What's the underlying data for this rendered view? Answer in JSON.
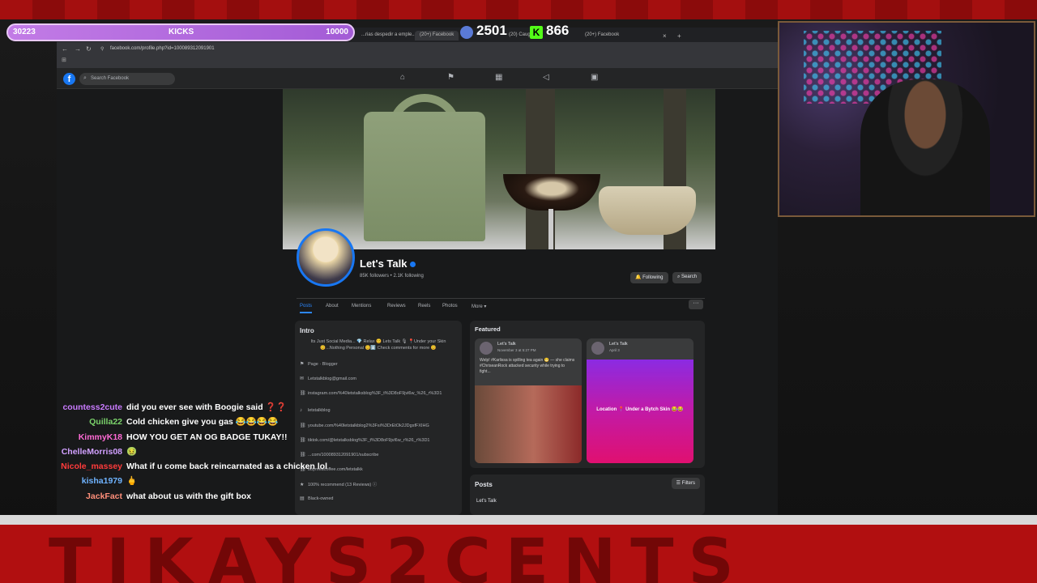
{
  "kicks_bar": {
    "left_count": "30223",
    "label": "KICKS",
    "goal": "10000"
  },
  "counters": {
    "viewers": "2501",
    "kick_count": "866"
  },
  "browser": {
    "tabs": [
      "...rias despedir a emple...",
      "(20+) Facebook",
      "(20) Caught...",
      "(20+) Facebook"
    ],
    "url": "facebook.com/profile.php?id=100089312091901"
  },
  "facebook": {
    "search_placeholder": "Search Facebook",
    "page_name": "Let's Talk",
    "stats": "85K followers • 2.1K following",
    "following_label": "Following",
    "search_label": "Search",
    "tabs": [
      "Posts",
      "About",
      "Mentions",
      "Reviews",
      "Reels",
      "Photos",
      "More ▾"
    ],
    "intro": {
      "title": "Intro",
      "bio": "Its Just Social Media... 💎 Relax 😊 Lets Talk 🎙 📍Under your Skin 😊...Nothing Personal 😊⬇️ Check comments for more 😊",
      "rows": [
        {
          "icon": "flag-icon",
          "text": "Page · Blogger"
        },
        {
          "icon": "mail-icon",
          "text": "Letstalkblog@gmail.com"
        },
        {
          "icon": "link-icon",
          "text": "instagram.com/%40letstalksblog%3F_t%3D8oF9jvl6w_%26_r%3D1"
        },
        {
          "icon": "tiktok-icon",
          "text": "letstalkblog"
        },
        {
          "icon": "link-icon",
          "text": "youtube.com/%40letstalkblog2%3Fsi%3DrEtOk2JDgsfFXIHG"
        },
        {
          "icon": "link-icon",
          "text": "tiktok.com/@letstalksblog%3F_t%3D8oF9jvl6w_r%26_r%3D1"
        },
        {
          "icon": "link-icon",
          "text": "...com/100089312091901/subscribe"
        },
        {
          "icon": "link-icon",
          "text": "buymeacoffee.com/letstalkk"
        },
        {
          "icon": "star-icon",
          "text": "100% recommend (13 Reviews) ⓘ"
        },
        {
          "icon": "lock-icon",
          "text": "Black-owned"
        }
      ]
    },
    "featured": {
      "title": "Featured",
      "card1": {
        "name": "Let's Talk",
        "date": "November 3 at 5:27 PM",
        "text": "Welp! #Karlissa is spilling tea again 😬 — she claims #ChriseanRock attacked security while trying to fight..."
      },
      "card2": {
        "name": "Let's Talk",
        "date": "April 3",
        "text": "Location 📍 Under a Bytch Skin 😂😂"
      }
    },
    "posts": {
      "title": "Posts",
      "filters_label": "Filters",
      "author": "Let's Talk"
    }
  },
  "chat": [
    {
      "user": "countess2cute",
      "color": "#c97bff",
      "msg": "did you ever see with Boogie said ❓❓"
    },
    {
      "user": "Quilla22",
      "color": "#7bd36b",
      "msg": "Cold chicken give you gas 😂😂😂😂"
    },
    {
      "user": "KimmyK18",
      "color": "#ff6ad5",
      "msg": "HOW YOU GET AN OG BADGE TUKAY!!"
    },
    {
      "user": "ChelleMorris08",
      "color": "#d1a0ff",
      "msg": "🤢"
    },
    {
      "user": "Nicole_massey",
      "color": "#ff3b3b",
      "msg": "What if u come back reincarnated as a chicken lol"
    },
    {
      "user": "kisha1979",
      "color": "#6fb3ff",
      "msg": "🖕"
    },
    {
      "user": "JackFact",
      "color": "#ff8f7a",
      "msg": "what about us with the gift box"
    }
  ],
  "banner_text": "TIKAYS2CENTS"
}
